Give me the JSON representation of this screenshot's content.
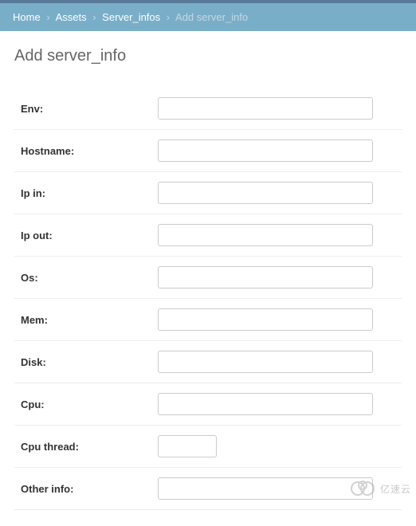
{
  "breadcrumb": {
    "home": "Home",
    "assets": "Assets",
    "server_infos": "Server_infos",
    "current": "Add server_info"
  },
  "page": {
    "title": "Add server_info"
  },
  "form": {
    "fields": [
      {
        "label": "Env:",
        "name": "env",
        "short": false
      },
      {
        "label": "Hostname:",
        "name": "hostname",
        "short": false
      },
      {
        "label": "Ip in:",
        "name": "ip-in",
        "short": false
      },
      {
        "label": "Ip out:",
        "name": "ip-out",
        "short": false
      },
      {
        "label": "Os:",
        "name": "os",
        "short": false
      },
      {
        "label": "Mem:",
        "name": "mem",
        "short": false
      },
      {
        "label": "Disk:",
        "name": "disk",
        "short": false
      },
      {
        "label": "Cpu:",
        "name": "cpu",
        "short": false
      },
      {
        "label": "Cpu thread:",
        "name": "cpu-thread",
        "short": true
      },
      {
        "label": "Other info:",
        "name": "other-info",
        "short": false
      }
    ]
  },
  "watermark": {
    "text": "亿速云"
  }
}
